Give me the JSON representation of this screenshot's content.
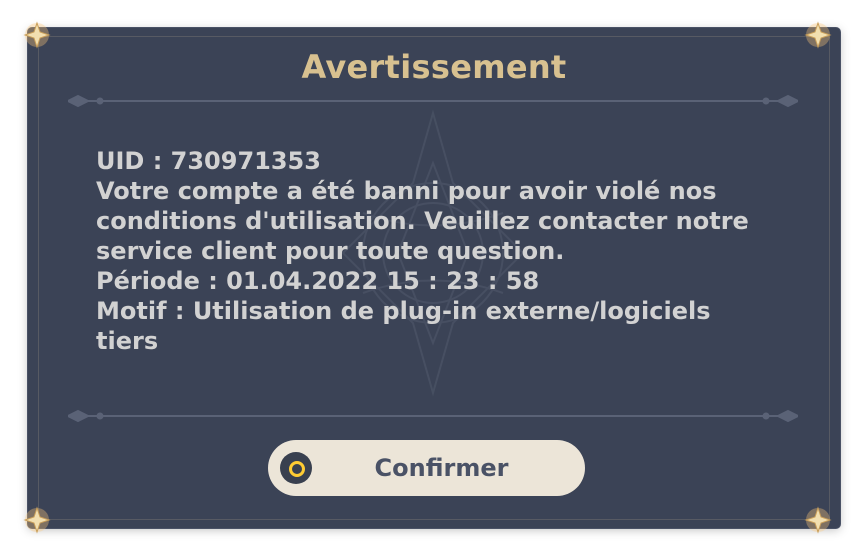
{
  "dialog": {
    "title": "Avertissement",
    "message_lines": [
      "UID : 730971353",
      "Votre compte a été banni pour avoir violé nos",
      "conditions d'utilisation. Veuillez contacter notre",
      "service client pour toute question.",
      "Période : 01.04.2022 15 : 23 : 58",
      "Motif : Utilisation de plug-in externe/logiciels",
      "tiers"
    ],
    "confirm_button": {
      "label": "Confirmer",
      "icon": "circle-confirm-icon"
    }
  },
  "colors": {
    "panel_background": "#3b4356",
    "title_gold": "#d8c190",
    "message_text": "#d2d2d2",
    "button_background": "#ece5d8",
    "button_text": "#4a5266",
    "icon_ring": "#ffcc33"
  }
}
